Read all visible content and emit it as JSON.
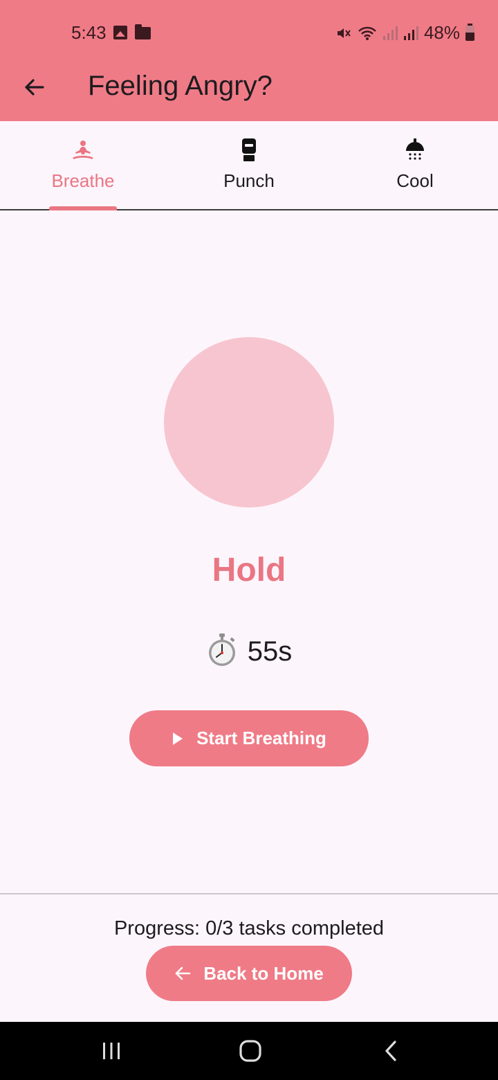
{
  "status_bar": {
    "time": "5:43",
    "battery": "48%"
  },
  "app_bar": {
    "title": "Feeling Angry?"
  },
  "tabs": [
    {
      "label": "Breathe",
      "icon": "meditation-icon",
      "active": true
    },
    {
      "label": "Punch",
      "icon": "boxing-glove-icon",
      "active": false
    },
    {
      "label": "Cool",
      "icon": "shower-icon",
      "active": false
    }
  ],
  "breathing": {
    "phase": "Hold",
    "timer_icon": "⏱️",
    "timer_value": "55s",
    "start_button": "Start Breathing"
  },
  "footer": {
    "progress_text": "Progress: 0/3 tasks completed",
    "home_button": "Back to Home"
  },
  "colors": {
    "accent": "#ef7b87",
    "accent_text": "#ea7683",
    "circle": "#f7c5cf",
    "background": "#fdf5fc"
  }
}
